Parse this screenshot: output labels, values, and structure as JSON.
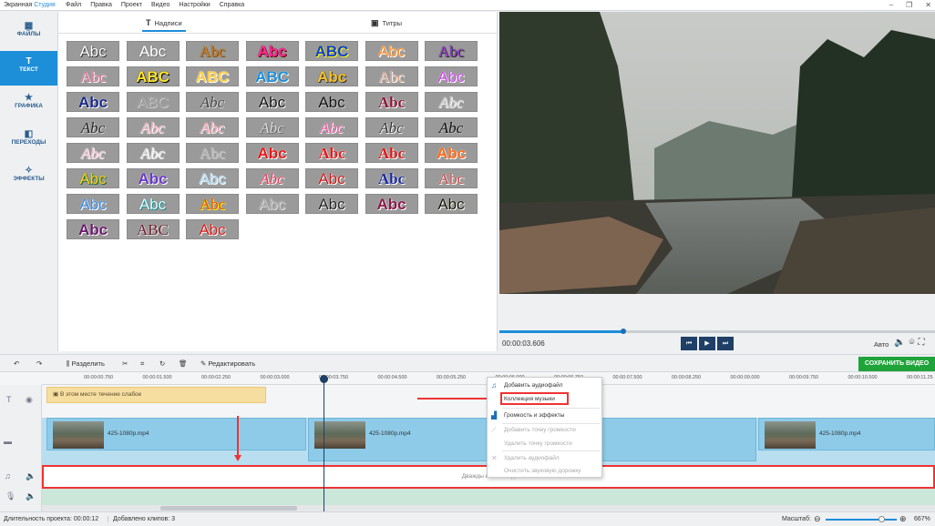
{
  "app": {
    "title_part1": "Экранная",
    "title_part2": "Студия"
  },
  "menu": [
    "Файл",
    "Правка",
    "Проект",
    "Видео",
    "Настройки",
    "Справка"
  ],
  "window_buttons": [
    "–",
    "❐",
    "✕"
  ],
  "sidebar": [
    {
      "label": "ФАЙЛЫ",
      "icon": "files-icon",
      "glyph": "▦"
    },
    {
      "label": "ТЕКСТ",
      "icon": "text-icon",
      "glyph": "T",
      "active": true
    },
    {
      "label": "ГРАФИКА",
      "icon": "star-icon",
      "glyph": "★"
    },
    {
      "label": "ПЕРЕХОДЫ",
      "icon": "transitions-icon",
      "glyph": "◧"
    },
    {
      "label": "ЭФФЕКТЫ",
      "icon": "magic-wand-icon",
      "glyph": "✧"
    }
  ],
  "library": {
    "tab_inscriptions": "Надписи",
    "tab_titles": "Титры",
    "tile_text": [
      "Abc",
      "Abc",
      "Abc",
      "Abc",
      "ABC",
      "Abc",
      "Abc",
      "Abc",
      "ABC",
      "ABC",
      "ABC",
      "Abc",
      "Abc",
      "Abc",
      "Abc",
      "ABC",
      "Abc",
      "Abc",
      "Abc",
      "Abc",
      "Abc",
      "Abc",
      "Abc",
      "Abc",
      "Abc",
      "Abc",
      "Abc",
      "Abc",
      "Abc",
      "Abc",
      "Abc",
      "Abc",
      "Abc",
      "Abc",
      "Abc",
      "Abc",
      "Abc",
      "Abc",
      "Abc",
      "Abc",
      "Abc",
      "Abc",
      "Abc",
      "Abc",
      "Abc",
      "Abc",
      "Abc",
      "Abc",
      "Abc",
      "Abc",
      "ABC",
      "Abc",
      "Abc",
      "ABC",
      "Abc",
      "Abc",
      "ABC",
      "Abc",
      "ABC"
    ]
  },
  "preview": {
    "timecode": "00:00:03.606",
    "auto_label": "Авто",
    "progress": 0.285
  },
  "toolbar": {
    "undo": "↶",
    "redo": "↷",
    "split": "Разделить",
    "edit": "Редактировать",
    "save": "СОХРАНИТЬ ВИДЕО"
  },
  "ruler": [
    "00:00:00.750",
    "00:00:01.500",
    "00:00:02.250",
    "00:00:03.000",
    "00:00:03.750",
    "00:00:04.500",
    "00:00:05.250",
    "00:00:06.000",
    "00:00:06.750",
    "00:00:07.500",
    "00:00:08.250",
    "00:00:09.000",
    "00:00:09.750",
    "00:00:10.500",
    "00:00:11.25"
  ],
  "timeline": {
    "text_clip": "В этом месте течение слабое",
    "clips": [
      "425-1080p.mp4",
      "425-1080p.mp4",
      "425-1080p.mp4"
    ],
    "audio_hint": "Дважды кликните д"
  },
  "context_menu": [
    "Добавить аудиофайл",
    "Коллекция музыки",
    "Громкость и эффекты",
    "Добавить точку громкости",
    "Удалить точку громкости",
    "Удалить аудиофайл",
    "Очистить звуковую дорожку"
  ],
  "status": {
    "duration_label": "Длительность проекта:",
    "duration_value": "00:00:12",
    "clips_label": "Добавлено клипов:",
    "clips_value": "3",
    "scale_label": "Масштаб:",
    "zoom": "667%"
  },
  "colors": {
    "accent": "#1d8ed8",
    "save": "#1fa33a",
    "highlight": "#e33333"
  }
}
